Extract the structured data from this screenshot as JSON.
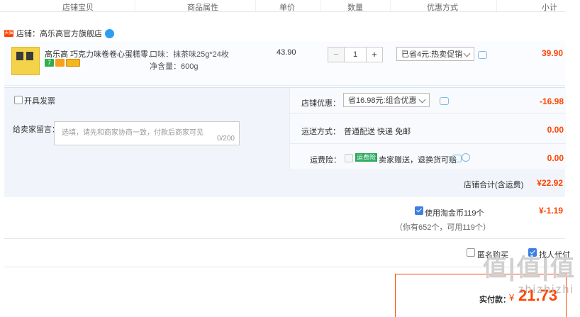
{
  "header": {
    "col_store": "店铺宝贝",
    "col_attr": "商品属性",
    "col_price": "单价",
    "col_qty": "数量",
    "col_promo": "优惠方式",
    "col_subtotal": "小计"
  },
  "store": {
    "badge": "天猫",
    "name": "店铺：高乐高官方旗舰店"
  },
  "item": {
    "title": "高乐高 巧克力味卷卷心蛋糕零...",
    "attr_flavor": "口味：抹茶味25g*24枚",
    "attr_net": "净含量：600g",
    "unit_price": "43.90",
    "qty_minus": "−",
    "qty": "1",
    "qty_plus": "+",
    "promo": "已省4元:热卖促销",
    "subtotal": "39.90",
    "pill_seven": "7"
  },
  "invoice": {
    "label": "开具发票"
  },
  "message": {
    "label": "给卖家留言：",
    "placeholder": "选填，请先和商家协商一致，付款后商家可见",
    "counter": "0/200"
  },
  "store_discount": {
    "label": "店铺优惠：",
    "value": "省16.98元:组合优惠",
    "amount": "-16.98"
  },
  "shipping": {
    "label": "运送方式：",
    "value": "普通配送 快递 免邮",
    "amount": "0.00"
  },
  "insurance": {
    "label": "运费险：",
    "tag": "运费险",
    "value": "卖家赠送，退换货可赔",
    "amount": "0.00"
  },
  "store_total": {
    "label": "店铺合计(含运费)",
    "amount": "¥22.92"
  },
  "coins": {
    "label": "使用淘金币119个",
    "amount": "¥-1.19",
    "note": "（你有652个，可用119个）"
  },
  "footer": {
    "anon_label": "匿名购买",
    "installment_label": "找人代付",
    "pay_label": "实付款：",
    "pay_currency": "¥",
    "pay_amount": "21.73"
  },
  "watermark": {
    "big": "值|值|值",
    "small": "zhizhizhi"
  },
  "colors": {
    "accent_red": "#ff4400",
    "panel_blue": "#f1f5fb",
    "check_blue": "#3b7fe6",
    "tag_green": "#27a95b"
  }
}
